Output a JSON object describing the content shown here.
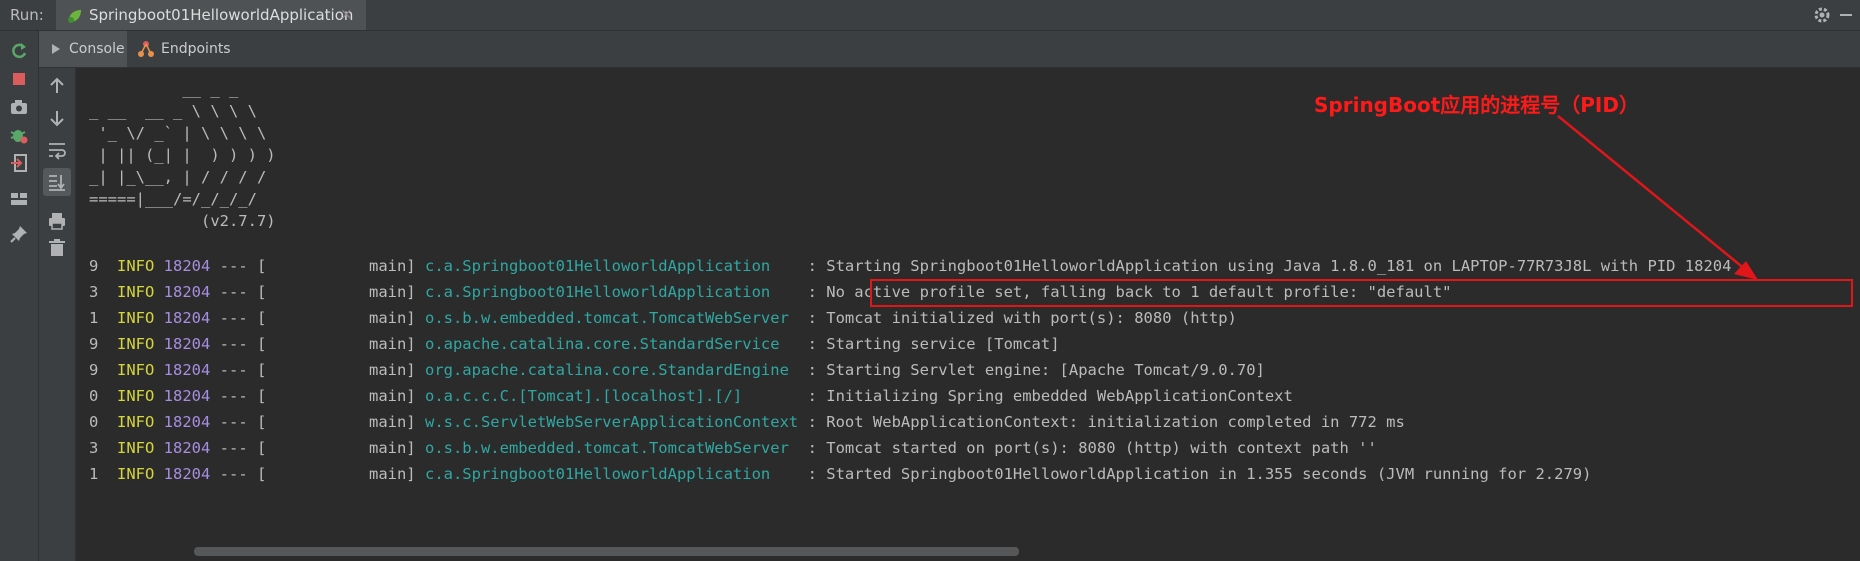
{
  "toolbar": {
    "run_label": "Run:",
    "run_tab_title": "Springboot01HelloworldApplication",
    "close_glyph": "×"
  },
  "subtabs": [
    {
      "label": "Console",
      "icon": "console-icon"
    },
    {
      "label": "Endpoints",
      "icon": "endpoints-icon"
    }
  ],
  "banner": [
    "          __ _ _",
    "_ __  __ _ \\ \\ \\ \\",
    " '_ \\/ _` | \\ \\ \\ \\",
    " | || (_| |  ) ) ) )",
    "_| |_\\__, | / / / /",
    "=====|___/=/_/_/_/",
    "            (v2.7.7)"
  ],
  "log": [
    {
      "pre": "9  ",
      "level": "INFO",
      "pid": "18204",
      "mid": " --- [           main] ",
      "cls": "c.a.Springboot01HelloworldApplication   ",
      "msg": " : Starting Springboot01HelloworldApplication using Java 1.8.0_181 on LAPTOP-77R73J8L with PID 18204"
    },
    {
      "pre": "3  ",
      "level": "INFO",
      "pid": "18204",
      "mid": " --- [           main] ",
      "cls": "c.a.Springboot01HelloworldApplication   ",
      "msg": " : No active profile set, falling back to 1 default profile: \"default\""
    },
    {
      "pre": "1  ",
      "level": "INFO",
      "pid": "18204",
      "mid": " --- [           main] ",
      "cls": "o.s.b.w.embedded.tomcat.TomcatWebServer ",
      "msg": " : Tomcat initialized with port(s): 8080 (http)"
    },
    {
      "pre": "9  ",
      "level": "INFO",
      "pid": "18204",
      "mid": " --- [           main] ",
      "cls": "o.apache.catalina.core.StandardService  ",
      "msg": " : Starting service [Tomcat]"
    },
    {
      "pre": "9  ",
      "level": "INFO",
      "pid": "18204",
      "mid": " --- [           main] ",
      "cls": "org.apache.catalina.core.StandardEngine ",
      "msg": " : Starting Servlet engine: [Apache Tomcat/9.0.70]"
    },
    {
      "pre": "0  ",
      "level": "INFO",
      "pid": "18204",
      "mid": " --- [           main] ",
      "cls": "o.a.c.c.C.[Tomcat].[localhost].[/]      ",
      "msg": " : Initializing Spring embedded WebApplicationContext"
    },
    {
      "pre": "0  ",
      "level": "INFO",
      "pid": "18204",
      "mid": " --- [           main] ",
      "cls": "w.s.c.ServletWebServerApplicationContext",
      "msg": " : Root WebApplicationContext: initialization completed in 772 ms"
    },
    {
      "pre": "3  ",
      "level": "INFO",
      "pid": "18204",
      "mid": " --- [           main] ",
      "cls": "o.s.b.w.embedded.tomcat.TomcatWebServer ",
      "msg": " : Tomcat started on port(s): 8080 (http) with context path ''"
    },
    {
      "pre": "1  ",
      "level": "INFO",
      "pid": "18204",
      "mid": " --- [           main] ",
      "cls": "c.a.Springboot01HelloworldApplication   ",
      "msg": " : Started Springboot01HelloworldApplication in 1.355 seconds (JVM running for 2.279)"
    }
  ],
  "annotation": {
    "text": "SpringBoot应用的进程号（PID）",
    "color": "#ff1a1a"
  },
  "left_toolbar_icons": [
    "rerun-icon",
    "stop-icon",
    "camera-icon",
    "debug-icon",
    "exit-icon",
    "layout-icon",
    "pin-icon"
  ],
  "console_toolbar_icons": [
    "arrow-up-icon",
    "arrow-down-icon",
    "soft-wrap-icon",
    "scroll-to-end-icon",
    "print-icon",
    "trash-icon"
  ],
  "colors": {
    "log_level": "#d6d63c",
    "pid": "#a58ee0",
    "logger": "#2fa8a3",
    "highlight": "#e0161b"
  }
}
